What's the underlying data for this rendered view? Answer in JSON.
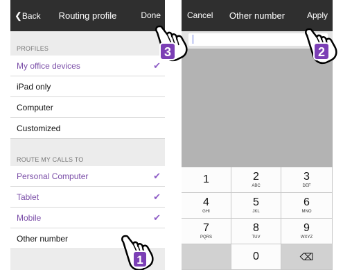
{
  "left_screen": {
    "nav": {
      "back": "Back",
      "title": "Routing profile",
      "done": "Done"
    },
    "profiles_header": "PROFILES",
    "profiles": [
      {
        "label": "My office devices",
        "checked": true
      },
      {
        "label": "iPad only",
        "checked": false
      },
      {
        "label": "Computer",
        "checked": false
      },
      {
        "label": "Customized",
        "checked": false
      }
    ],
    "route_header": "ROUTE MY CALLS TO",
    "routes": [
      {
        "label": "Personal Computer",
        "checked": true
      },
      {
        "label": "Tablet",
        "checked": true
      },
      {
        "label": "Mobile",
        "checked": true
      },
      {
        "label": "Other number",
        "checked": false
      }
    ]
  },
  "right_screen": {
    "nav": {
      "cancel": "Cancel",
      "title": "Other number",
      "apply": "Apply"
    },
    "input_value": "",
    "keypad": [
      {
        "digit": "1",
        "letters": ""
      },
      {
        "digit": "2",
        "letters": "ABC"
      },
      {
        "digit": "3",
        "letters": "DEF"
      },
      {
        "digit": "4",
        "letters": "GHI"
      },
      {
        "digit": "5",
        "letters": "JKL"
      },
      {
        "digit": "6",
        "letters": "MNO"
      },
      {
        "digit": "7",
        "letters": "PQRS"
      },
      {
        "digit": "8",
        "letters": "TUV"
      },
      {
        "digit": "9",
        "letters": "WXYZ"
      },
      {
        "digit": "",
        "letters": ""
      },
      {
        "digit": "0",
        "letters": ""
      },
      {
        "digit": "⌫",
        "letters": ""
      }
    ]
  },
  "callouts": [
    "1",
    "2",
    "3"
  ],
  "colors": {
    "accent": "#7b4ea8",
    "check": "#8d5cc6",
    "navbar": "#2f2f2f",
    "callout": "#7b3fb5"
  }
}
